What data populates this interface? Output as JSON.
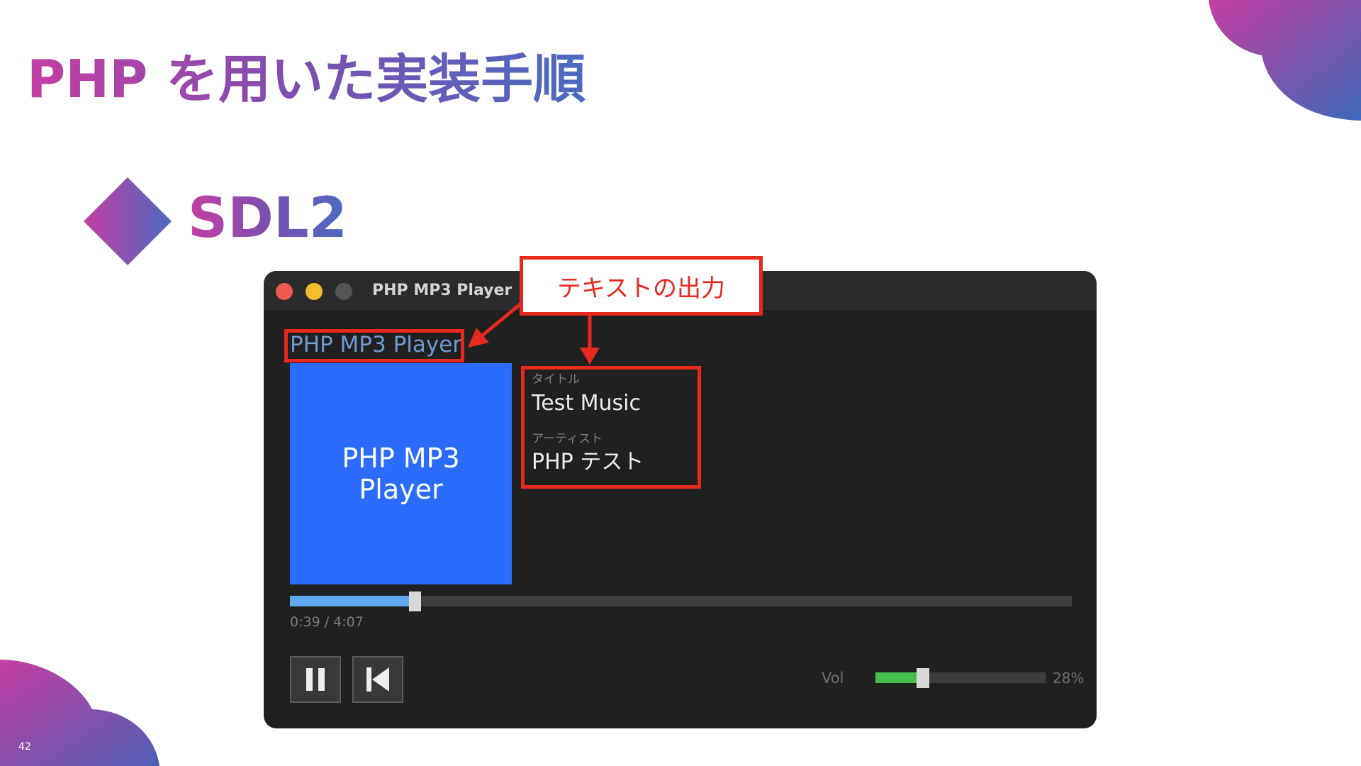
{
  "slide": {
    "title": "PHP を用いた実装手順",
    "section": "SDL2",
    "page_number": "42",
    "colors": {
      "gradient_start": "#c43ea3",
      "gradient_end": "#4a6bc0",
      "annotation_red": "#e8291f"
    }
  },
  "window": {
    "title": "PHP MP3 Player",
    "controls": [
      "close",
      "minimize",
      "zoom"
    ]
  },
  "player": {
    "heading": "PHP MP3 Player",
    "album_art_text": "PHP MP3 Player",
    "title_label": "タイトル",
    "title_value": "Test Music",
    "artist_label": "アーティスト",
    "artist_value": "PHP テスト",
    "progress_fraction": 0.16,
    "time_display": "0:39 / 4:07",
    "buttons": {
      "pause_icon": "pause-icon",
      "previous_icon": "skip-previous-icon"
    },
    "volume_label": "Vol",
    "volume_fraction": 0.28,
    "volume_display": "28%",
    "colors": {
      "album_art": "#2b6cff",
      "progress": "#5fa9f1",
      "volume": "#48c04e"
    }
  },
  "annotation": {
    "callout_text": "テキストの出力"
  }
}
